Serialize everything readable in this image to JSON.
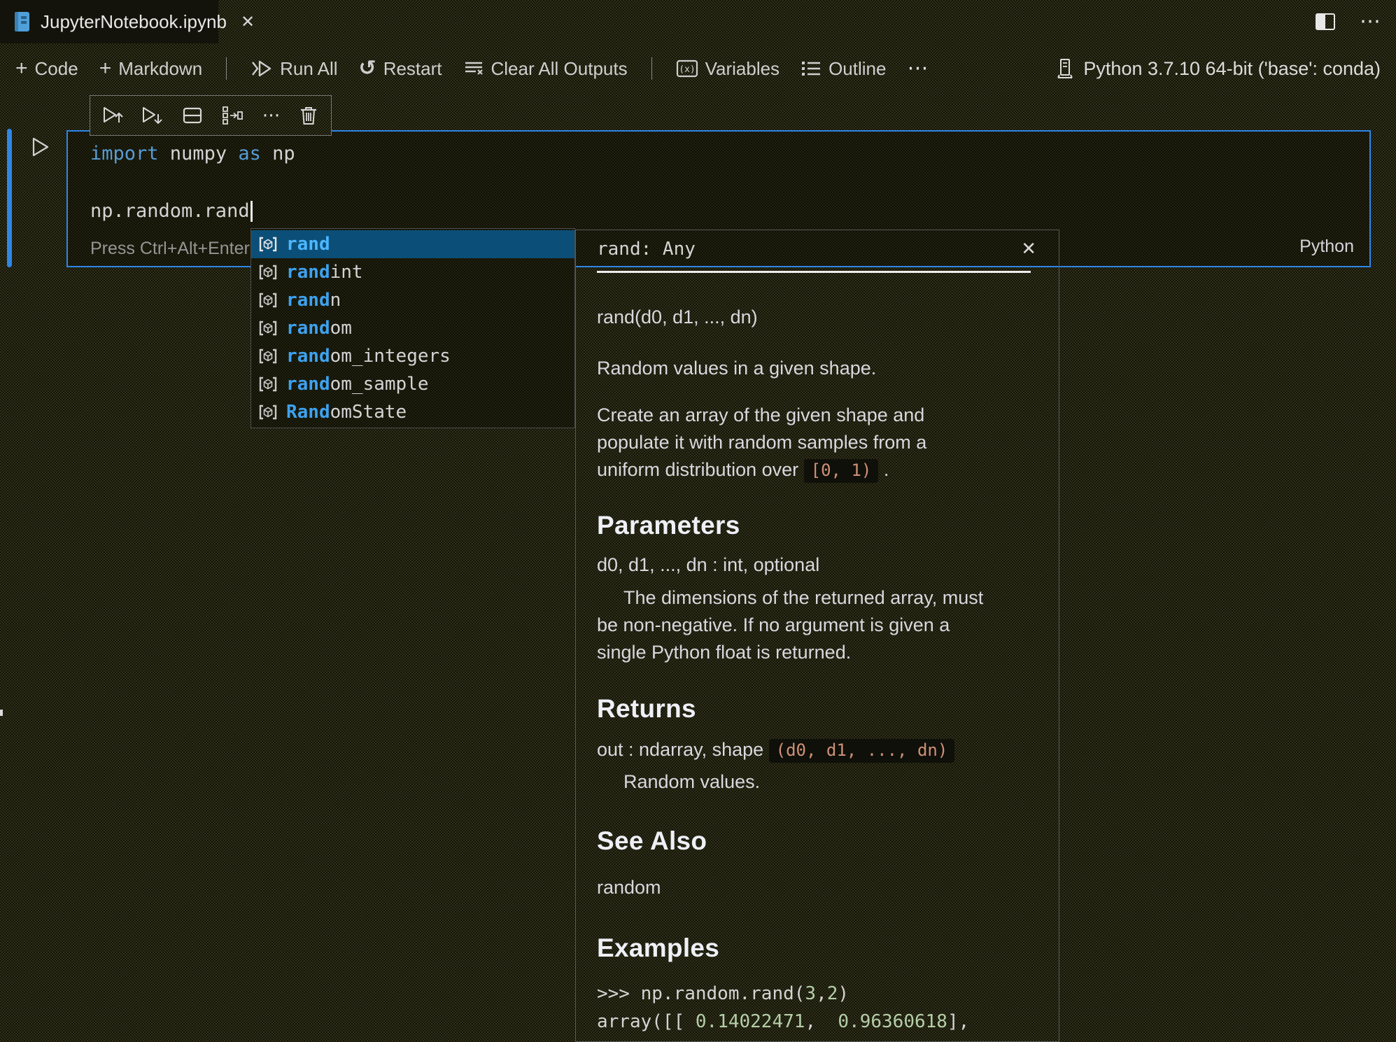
{
  "window": {
    "tab_title": "JupyterNotebook.ipynb"
  },
  "icons": {
    "close": "✕",
    "plus": "+",
    "ellipsis": "⋯",
    "restart": "↺"
  },
  "toolbar": {
    "code": "Code",
    "markdown": "Markdown",
    "run_all": "Run All",
    "restart": "Restart",
    "clear_outputs": "Clear All Outputs",
    "variables": "Variables",
    "outline": "Outline",
    "kernel": "Python 3.7.10 64-bit ('base': conda)"
  },
  "cell": {
    "code": {
      "l1_kw1": "import",
      "l1_id1": " numpy ",
      "l1_kw2": "as",
      "l1_id2": " np",
      "l3": "np.random.rand"
    },
    "hint": "Press Ctrl+Alt+Enter",
    "language": "Python"
  },
  "suggest": {
    "items": [
      {
        "match": "rand",
        "rest": ""
      },
      {
        "match": "rand",
        "rest": "int"
      },
      {
        "match": "rand",
        "rest": "n"
      },
      {
        "match": "rand",
        "rest": "om"
      },
      {
        "match": "rand",
        "rest": "om_integers"
      },
      {
        "match": "rand",
        "rest": "om_sample"
      },
      {
        "match": "Rand",
        "rest": "omState"
      }
    ]
  },
  "hover": {
    "title": "rand: Any",
    "signature": "rand(d0, d1, ..., dn)",
    "summary": "Random values in a given shape.",
    "description_lines": [
      "Create an array of the given shape and",
      "populate it with random samples from a",
      "uniform distribution over "
    ],
    "description_code": "[0, 1)",
    "description_end": " .",
    "parameters": {
      "heading": "Parameters",
      "term": "d0, d1, ..., dn : int, optional",
      "definition_lines": [
        "The dimensions of the returned array, must",
        "be non-negative. If no argument is given a",
        "single Python float is returned."
      ]
    },
    "returns": {
      "heading": "Returns",
      "term_text": "out : ndarray, shape ",
      "term_code": "(d0, d1, ..., dn)",
      "definition": "Random values."
    },
    "see_also": {
      "heading": "See Also",
      "text": "random"
    },
    "examples": {
      "heading": "Examples",
      "line1": [
        ">>> np.random.rand(",
        "3",
        ",",
        "2",
        ")"
      ],
      "line2": [
        "array([[ ",
        "0.14022471",
        ",  ",
        "0.96360618",
        "],"
      ]
    }
  },
  "colors": {
    "accent_blue": "#2e86e8",
    "match_blue": "#3da2f0",
    "keyword_blue": "#569cd6",
    "number_green": "#b5cea8",
    "code_orange": "#ce9178",
    "selection_bg": "#0b4f78"
  }
}
